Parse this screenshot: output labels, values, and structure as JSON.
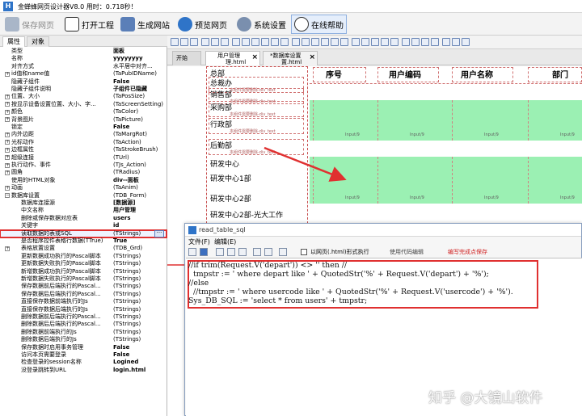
{
  "app": {
    "title": "金蝉蜂网页设计器V8.0  用时：0.718秒！",
    "logo": "H"
  },
  "toolbar": {
    "save": "保存网页",
    "open": "打开工程",
    "generate": "生成网站",
    "preview": "预览网页",
    "settings": "系统设置",
    "help": "在线帮助"
  },
  "left_tabs": [
    "属性",
    "对象"
  ],
  "properties": [
    {
      "k": "类型",
      "v": "面板",
      "bold": true
    },
    {
      "k": "名称",
      "v": "yyyyyyyy",
      "bold": true
    },
    {
      "k": "对齐方式",
      "v": "水平居中对齐..."
    },
    {
      "k": "id值和name值",
      "v": "(TaPubIDName)",
      "plus": true
    },
    {
      "k": "隐藏子组件",
      "v": "False",
      "bold": true
    },
    {
      "k": "隐藏子组件说明",
      "v": "子组件已隐藏",
      "bold": true
    },
    {
      "k": "位置、大小",
      "v": "(TaPosSize)",
      "plus": true
    },
    {
      "k": "按显示设备设置位置、大小、字...",
      "v": "(TaScreenSetting)",
      "plus": true
    },
    {
      "k": "颜色",
      "v": "(TaColor)",
      "plus": true
    },
    {
      "k": "背景图片",
      "v": "(TaPicture)",
      "plus": true
    },
    {
      "k": "锁定",
      "v": "False",
      "bold": true
    },
    {
      "k": "内外边距",
      "v": "(TaMargRot)",
      "plus": true
    },
    {
      "k": "光标动作",
      "v": "(TaAction)",
      "plus": true
    },
    {
      "k": "边框属性",
      "v": "(TaStrokeBrush)",
      "plus": true
    },
    {
      "k": "超级连接",
      "v": "(TUrl)",
      "plus": true
    },
    {
      "k": "执行动作、事件",
      "v": "(TJs_Action)",
      "plus": true
    },
    {
      "k": "圆角",
      "v": "(TRadius)",
      "plus": true
    },
    {
      "k": "使用的HTML对象",
      "v": "div--面板",
      "bold": true
    },
    {
      "k": "动画",
      "v": "(TaAnim)",
      "plus": true
    },
    {
      "k": "数据库设置",
      "v": "(TDB_Form)",
      "minus": true
    },
    {
      "k": "数据库连接源",
      "v": "[数据源]",
      "bold": true,
      "indent": true
    },
    {
      "k": "中文名称",
      "v": "用户管理",
      "bold": true,
      "indent": true
    },
    {
      "k": "删除或保存数据对应表",
      "v": "users",
      "bold": true,
      "indent": true
    },
    {
      "k": "关键字",
      "v": "id",
      "bold": true,
      "indent": true
    },
    {
      "k": "读取数据的表或SQL",
      "v": "(TStrings)",
      "indent": true,
      "selected": true
    },
    {
      "k": "是否程序控件表格行数据(TTrue)",
      "v": "True",
      "bold": true,
      "indent": true
    },
    {
      "k": "表格放置设置",
      "v": "(TDB_Grd)",
      "indent": true,
      "plus": true
    },
    {
      "k": "更新数据成功执行的Pascal脚本",
      "v": "(TStrings)",
      "indent": true
    },
    {
      "k": "更新数据失败执行的Pascal脚本",
      "v": "(TStrings)",
      "indent": true
    },
    {
      "k": "新增数据成功执行的Pascal脚本",
      "v": "(TStrings)",
      "indent": true
    },
    {
      "k": "新增数据失败执行的Pascal脚本",
      "v": "(TStrings)",
      "indent": true
    },
    {
      "k": "保存数据前后端执行的Pascal...",
      "v": "(TStrings)",
      "indent": true
    },
    {
      "k": "保存数据后后端执行的Pascal...",
      "v": "(TStrings)",
      "indent": true
    },
    {
      "k": "直接保存数据前端执行的Js",
      "v": "(TStrings)",
      "indent": true
    },
    {
      "k": "直接保存数据后端执行的Js",
      "v": "(TStrings)",
      "indent": true
    },
    {
      "k": "删除数据前后端执行的Pascal...",
      "v": "(TStrings)",
      "indent": true
    },
    {
      "k": "删除数据后后端执行的Pascal...",
      "v": "(TStrings)",
      "indent": true
    },
    {
      "k": "删除数据前端执行的Js",
      "v": "(TStrings)",
      "indent": true
    },
    {
      "k": "删除数据后端执行的Js",
      "v": "(TStrings)",
      "indent": true
    },
    {
      "k": "保存数据时启用事务管理",
      "v": "False",
      "bold": true,
      "indent": true
    },
    {
      "k": "访问本页需要登录",
      "v": "False",
      "bold": true,
      "indent": true
    },
    {
      "k": "检查登录的session名称",
      "v": "Logined",
      "bold": true,
      "indent": true
    },
    {
      "k": "没登录跳转到URL",
      "v": "login.html",
      "bold": true,
      "indent": true
    }
  ],
  "doc_tabs": [
    {
      "label": "开始"
    },
    {
      "label": "用户管理",
      "sub": "理.html"
    },
    {
      "label": "*数据库设置",
      "sub": "置.html"
    }
  ],
  "canvas": {
    "nav_items": [
      "总部",
      "总裁办",
      "销售部",
      "采购部",
      "行政部",
      "后勤部",
      "研发中心",
      "研发中心1部",
      "研发中心2部",
      "研发中心2部-光大工作"
    ],
    "nav_sub": "本组件需要删除-div_text",
    "columns": [
      "序号",
      "用户编码",
      "用户名称",
      "部门"
    ],
    "input_label": "Input/9"
  },
  "dialog": {
    "title": "read_table_sql",
    "menu": [
      "文件(F)",
      "编辑(E)"
    ],
    "run_label": "以网页(.html)形式执行",
    "hint_label": "使用代码编辑",
    "tip_label": "编写完成点保存",
    "code": [
      "//if trim(Request.V('depart')) <> '' then //",
      "  tmpstr := ' where depart like ' + QuotedStr('%' + Request.V('depart') + '%');",
      "//else",
      "  //tmpstr := ' where usercode like ' + QuotedStr('%' + Request.V('usercode') + '%').",
      "Sys_DB_SQL := 'select * from users' + tmpstr;"
    ]
  },
  "watermark": "知乎 @大镜山软件",
  "colors": {
    "highlight_red": "#e03030",
    "row_green": "#9bf0b3",
    "accent_blue": "#2f74c8"
  }
}
